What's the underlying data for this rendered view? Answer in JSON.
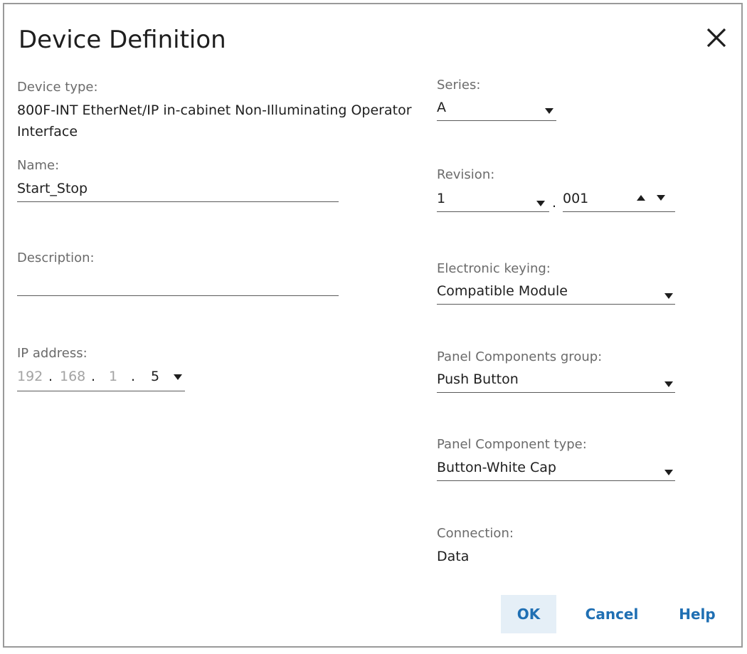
{
  "dialog": {
    "title": "Device Definition"
  },
  "device_type": {
    "label": "Device type:",
    "value": "800F-INT EtherNet/IP in-cabinet Non-Illuminating Operator Interface"
  },
  "name": {
    "label": "Name:",
    "value": "Start_Stop"
  },
  "description": {
    "label": "Description:",
    "value": ""
  },
  "ip_address": {
    "label": "IP address:",
    "octet1": "192",
    "octet2": "168",
    "octet3": "1",
    "octet4": "5",
    "sep": "."
  },
  "series": {
    "label": "Series:",
    "value": "A"
  },
  "revision": {
    "label": "Revision:",
    "major": "1",
    "sep": ".",
    "minor": "001"
  },
  "electronic_keying": {
    "label": "Electronic keying:",
    "value": "Compatible Module"
  },
  "panel_group": {
    "label": "Panel Components group:",
    "value": "Push Button"
  },
  "panel_type": {
    "label": "Panel Component type:",
    "value": "Button-White Cap"
  },
  "connection": {
    "label": "Connection:",
    "value": "Data"
  },
  "buttons": {
    "ok": "OK",
    "cancel": "Cancel",
    "help": "Help"
  },
  "colors": {
    "accent": "#1f6fb3",
    "primary_bg": "#e5eff7",
    "label": "#6b6b6b",
    "disabled": "#a3a3a3"
  },
  "icons": {
    "close": "close-icon",
    "dropdown": "chevron-down-icon",
    "spin_up": "chevron-up-icon"
  }
}
